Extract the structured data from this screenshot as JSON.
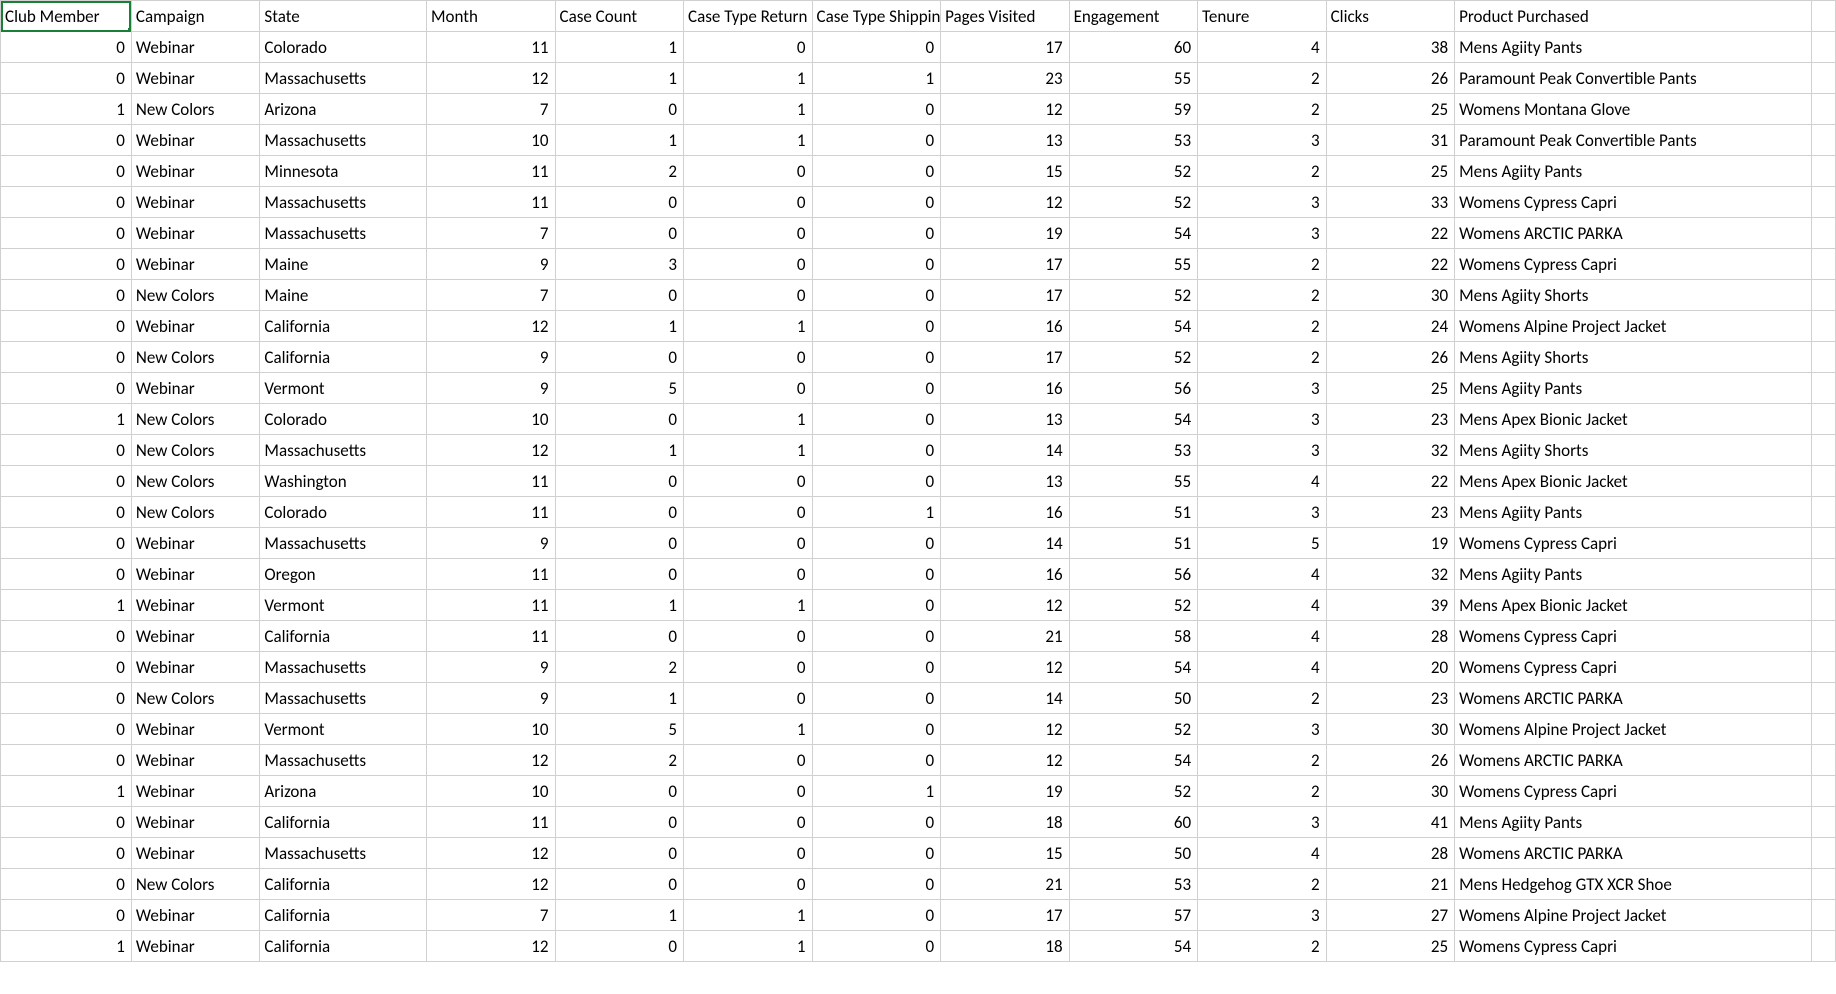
{
  "headers": [
    "Club Member",
    "Campaign",
    "State",
    "Month",
    "Case Count",
    "Case Type Return",
    "Case Type Shipping",
    "Pages Visited",
    "Engagement",
    "Tenure",
    "Clicks",
    "Product Purchased"
  ],
  "column_alignment": [
    "num",
    "txt",
    "txt",
    "num",
    "num",
    "num",
    "num",
    "num",
    "num",
    "num",
    "num",
    "txt"
  ],
  "rows": [
    [
      0,
      "Webinar",
      "Colorado",
      11,
      1,
      0,
      0,
      17,
      60,
      4,
      38,
      "Mens Agiity Pants"
    ],
    [
      0,
      "Webinar",
      "Massachusetts",
      12,
      1,
      1,
      1,
      23,
      55,
      2,
      26,
      "Paramount Peak Convertible Pants"
    ],
    [
      1,
      "New Colors",
      "Arizona",
      7,
      0,
      1,
      0,
      12,
      59,
      2,
      25,
      "Womens Montana Glove"
    ],
    [
      0,
      "Webinar",
      "Massachusetts",
      10,
      1,
      1,
      0,
      13,
      53,
      3,
      31,
      "Paramount Peak Convertible Pants"
    ],
    [
      0,
      "Webinar",
      "Minnesota",
      11,
      2,
      0,
      0,
      15,
      52,
      2,
      25,
      "Mens Agiity Pants"
    ],
    [
      0,
      "Webinar",
      "Massachusetts",
      11,
      0,
      0,
      0,
      12,
      52,
      3,
      33,
      "Womens Cypress Capri"
    ],
    [
      0,
      "Webinar",
      "Massachusetts",
      7,
      0,
      0,
      0,
      19,
      54,
      3,
      22,
      "Womens ARCTIC PARKA"
    ],
    [
      0,
      "Webinar",
      "Maine",
      9,
      3,
      0,
      0,
      17,
      55,
      2,
      22,
      "Womens Cypress Capri"
    ],
    [
      0,
      "New Colors",
      "Maine",
      7,
      0,
      0,
      0,
      17,
      52,
      2,
      30,
      "Mens Agiity Shorts"
    ],
    [
      0,
      "Webinar",
      "California",
      12,
      1,
      1,
      0,
      16,
      54,
      2,
      24,
      "Womens Alpine Project Jacket"
    ],
    [
      0,
      "New Colors",
      "California",
      9,
      0,
      0,
      0,
      17,
      52,
      2,
      26,
      "Mens Agiity Shorts"
    ],
    [
      0,
      "Webinar",
      "Vermont",
      9,
      5,
      0,
      0,
      16,
      56,
      3,
      25,
      "Mens Agiity Pants"
    ],
    [
      1,
      "New Colors",
      "Colorado",
      10,
      0,
      1,
      0,
      13,
      54,
      3,
      23,
      "Mens Apex Bionic Jacket"
    ],
    [
      0,
      "New Colors",
      "Massachusetts",
      12,
      1,
      1,
      0,
      14,
      53,
      3,
      32,
      "Mens Agiity Shorts"
    ],
    [
      0,
      "New Colors",
      "Washington",
      11,
      0,
      0,
      0,
      13,
      55,
      4,
      22,
      "Mens Apex Bionic Jacket"
    ],
    [
      0,
      "New Colors",
      "Colorado",
      11,
      0,
      0,
      1,
      16,
      51,
      3,
      23,
      "Mens Agiity Pants"
    ],
    [
      0,
      "Webinar",
      "Massachusetts",
      9,
      0,
      0,
      0,
      14,
      51,
      5,
      19,
      "Womens Cypress Capri"
    ],
    [
      0,
      "Webinar",
      "Oregon",
      11,
      0,
      0,
      0,
      16,
      56,
      4,
      32,
      "Mens Agiity Pants"
    ],
    [
      1,
      "Webinar",
      "Vermont",
      11,
      1,
      1,
      0,
      12,
      52,
      4,
      39,
      "Mens Apex Bionic Jacket"
    ],
    [
      0,
      "Webinar",
      "California",
      11,
      0,
      0,
      0,
      21,
      58,
      4,
      28,
      "Womens Cypress Capri"
    ],
    [
      0,
      "Webinar",
      "Massachusetts",
      9,
      2,
      0,
      0,
      12,
      54,
      4,
      20,
      "Womens Cypress Capri"
    ],
    [
      0,
      "New Colors",
      "Massachusetts",
      9,
      1,
      0,
      0,
      14,
      50,
      2,
      23,
      "Womens ARCTIC PARKA"
    ],
    [
      0,
      "Webinar",
      "Vermont",
      10,
      5,
      1,
      0,
      12,
      52,
      3,
      30,
      "Womens Alpine Project Jacket"
    ],
    [
      0,
      "Webinar",
      "Massachusetts",
      12,
      2,
      0,
      0,
      12,
      54,
      2,
      26,
      "Womens ARCTIC PARKA"
    ],
    [
      1,
      "Webinar",
      "Arizona",
      10,
      0,
      0,
      1,
      19,
      52,
      2,
      30,
      "Womens Cypress Capri"
    ],
    [
      0,
      "Webinar",
      "California",
      11,
      0,
      0,
      0,
      18,
      60,
      3,
      41,
      "Mens Agiity Pants"
    ],
    [
      0,
      "Webinar",
      "Massachusetts",
      12,
      0,
      0,
      0,
      15,
      50,
      4,
      28,
      "Womens ARCTIC PARKA"
    ],
    [
      0,
      "New Colors",
      "California",
      12,
      0,
      0,
      0,
      21,
      53,
      2,
      21,
      "Mens Hedgehog GTX XCR Shoe"
    ],
    [
      0,
      "Webinar",
      "California",
      7,
      1,
      1,
      0,
      17,
      57,
      3,
      27,
      "Womens Alpine Project Jacket"
    ],
    [
      1,
      "Webinar",
      "California",
      12,
      0,
      1,
      0,
      18,
      54,
      2,
      25,
      "Womens Cypress Capri"
    ]
  ]
}
